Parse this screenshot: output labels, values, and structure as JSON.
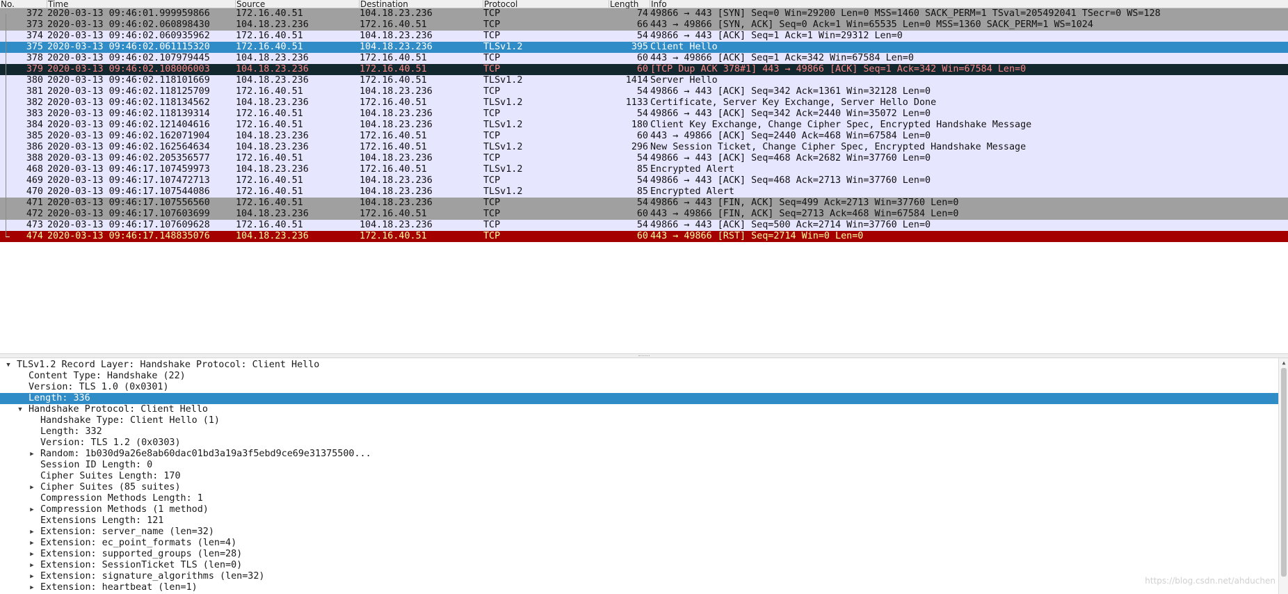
{
  "columns": {
    "no": "No.",
    "time": "Time",
    "source": "Source",
    "destination": "Destination",
    "protocol": "Protocol",
    "length": "Length",
    "info": "Info"
  },
  "colors": {
    "tcp_gray": "#a0a0a0",
    "lavender": "#e7e6ff",
    "selected": "#308cc6",
    "bad_tcp": "#12272e",
    "bad_tcp_text": "#f78787",
    "rst_red": "#a40000",
    "rst_text": "#ffffa0"
  },
  "packets": [
    {
      "no": "372",
      "time": "2020-03-13 09:46:01.999959866",
      "src": "172.16.40.51",
      "dst": "104.18.23.236",
      "proto": "TCP",
      "len": "74",
      "info": "49866 → 443 [SYN] Seq=0 Win=29200 Len=0 MSS=1460 SACK_PERM=1 TSval=205492041 TSecr=0 WS=128",
      "style": "gray"
    },
    {
      "no": "373",
      "time": "2020-03-13 09:46:02.060898430",
      "src": "104.18.23.236",
      "dst": "172.16.40.51",
      "proto": "TCP",
      "len": "66",
      "info": "443 → 49866 [SYN, ACK] Seq=0 Ack=1 Win=65535 Len=0 MSS=1360 SACK_PERM=1 WS=1024",
      "style": "gray"
    },
    {
      "no": "374",
      "time": "2020-03-13 09:46:02.060935962",
      "src": "172.16.40.51",
      "dst": "104.18.23.236",
      "proto": "TCP",
      "len": "54",
      "info": "49866 → 443 [ACK] Seq=1 Ack=1 Win=29312 Len=0",
      "style": "lavender"
    },
    {
      "no": "375",
      "time": "2020-03-13 09:46:02.061115320",
      "src": "172.16.40.51",
      "dst": "104.18.23.236",
      "proto": "TLSv1.2",
      "len": "395",
      "info": "Client Hello",
      "style": "selected"
    },
    {
      "no": "378",
      "time": "2020-03-13 09:46:02.107979445",
      "src": "104.18.23.236",
      "dst": "172.16.40.51",
      "proto": "TCP",
      "len": "60",
      "info": "443 → 49866 [ACK] Seq=1 Ack=342 Win=67584 Len=0",
      "style": "lavender"
    },
    {
      "no": "379",
      "time": "2020-03-13 09:46:02.108006003",
      "src": "104.18.23.236",
      "dst": "172.16.40.51",
      "proto": "TCP",
      "len": "60",
      "info": "[TCP Dup ACK 378#1] 443 → 49866 [ACK] Seq=1 Ack=342 Win=67584 Len=0",
      "style": "bad"
    },
    {
      "no": "380",
      "time": "2020-03-13 09:46:02.118101669",
      "src": "104.18.23.236",
      "dst": "172.16.40.51",
      "proto": "TLSv1.2",
      "len": "1414",
      "info": "Server Hello",
      "style": "lavender"
    },
    {
      "no": "381",
      "time": "2020-03-13 09:46:02.118125709",
      "src": "172.16.40.51",
      "dst": "104.18.23.236",
      "proto": "TCP",
      "len": "54",
      "info": "49866 → 443 [ACK] Seq=342 Ack=1361 Win=32128 Len=0",
      "style": "lavender"
    },
    {
      "no": "382",
      "time": "2020-03-13 09:46:02.118134562",
      "src": "104.18.23.236",
      "dst": "172.16.40.51",
      "proto": "TLSv1.2",
      "len": "1133",
      "info": "Certificate, Server Key Exchange, Server Hello Done",
      "style": "lavender"
    },
    {
      "no": "383",
      "time": "2020-03-13 09:46:02.118139314",
      "src": "172.16.40.51",
      "dst": "104.18.23.236",
      "proto": "TCP",
      "len": "54",
      "info": "49866 → 443 [ACK] Seq=342 Ack=2440 Win=35072 Len=0",
      "style": "lavender"
    },
    {
      "no": "384",
      "time": "2020-03-13 09:46:02.121404616",
      "src": "172.16.40.51",
      "dst": "104.18.23.236",
      "proto": "TLSv1.2",
      "len": "180",
      "info": "Client Key Exchange, Change Cipher Spec, Encrypted Handshake Message",
      "style": "lavender"
    },
    {
      "no": "385",
      "time": "2020-03-13 09:46:02.162071904",
      "src": "104.18.23.236",
      "dst": "172.16.40.51",
      "proto": "TCP",
      "len": "60",
      "info": "443 → 49866 [ACK] Seq=2440 Ack=468 Win=67584 Len=0",
      "style": "lavender"
    },
    {
      "no": "386",
      "time": "2020-03-13 09:46:02.162564634",
      "src": "104.18.23.236",
      "dst": "172.16.40.51",
      "proto": "TLSv1.2",
      "len": "296",
      "info": "New Session Ticket, Change Cipher Spec, Encrypted Handshake Message",
      "style": "lavender"
    },
    {
      "no": "388",
      "time": "2020-03-13 09:46:02.205356577",
      "src": "172.16.40.51",
      "dst": "104.18.23.236",
      "proto": "TCP",
      "len": "54",
      "info": "49866 → 443 [ACK] Seq=468 Ack=2682 Win=37760 Len=0",
      "style": "lavender"
    },
    {
      "no": "468",
      "time": "2020-03-13 09:46:17.107459973",
      "src": "104.18.23.236",
      "dst": "172.16.40.51",
      "proto": "TLSv1.2",
      "len": "85",
      "info": "Encrypted Alert",
      "style": "lavender"
    },
    {
      "no": "469",
      "time": "2020-03-13 09:46:17.107472713",
      "src": "172.16.40.51",
      "dst": "104.18.23.236",
      "proto": "TCP",
      "len": "54",
      "info": "49866 → 443 [ACK] Seq=468 Ack=2713 Win=37760 Len=0",
      "style": "lavender"
    },
    {
      "no": "470",
      "time": "2020-03-13 09:46:17.107544086",
      "src": "172.16.40.51",
      "dst": "104.18.23.236",
      "proto": "TLSv1.2",
      "len": "85",
      "info": "Encrypted Alert",
      "style": "lavender"
    },
    {
      "no": "471",
      "time": "2020-03-13 09:46:17.107556560",
      "src": "172.16.40.51",
      "dst": "104.18.23.236",
      "proto": "TCP",
      "len": "54",
      "info": "49866 → 443 [FIN, ACK] Seq=499 Ack=2713 Win=37760 Len=0",
      "style": "gray"
    },
    {
      "no": "472",
      "time": "2020-03-13 09:46:17.107603699",
      "src": "104.18.23.236",
      "dst": "172.16.40.51",
      "proto": "TCP",
      "len": "60",
      "info": "443 → 49866 [FIN, ACK] Seq=2713 Ack=468 Win=67584 Len=0",
      "style": "gray"
    },
    {
      "no": "473",
      "time": "2020-03-13 09:46:17.107609628",
      "src": "172.16.40.51",
      "dst": "104.18.23.236",
      "proto": "TCP",
      "len": "54",
      "info": "49866 → 443 [ACK] Seq=500 Ack=2714 Win=37760 Len=0",
      "style": "lavender"
    },
    {
      "no": "474",
      "time": "2020-03-13 09:46:17.148835076",
      "src": "104.18.23.236",
      "dst": "172.16.40.51",
      "proto": "TCP",
      "len": "60",
      "info": "443 → 49866 [RST] Seq=2714 Win=0 Len=0",
      "style": "rst"
    }
  ],
  "detail_tree": [
    {
      "text": "TLSv1.2 Record Layer: Handshake Protocol: Client Hello",
      "level": 0,
      "toggle": "open"
    },
    {
      "text": "Content Type: Handshake (22)",
      "level": 1,
      "toggle": "none"
    },
    {
      "text": "Version: TLS 1.0 (0x0301)",
      "level": 1,
      "toggle": "none"
    },
    {
      "text": "Length: 336",
      "level": 1,
      "toggle": "none",
      "selected": true
    },
    {
      "text": "Handshake Protocol: Client Hello",
      "level": 1,
      "toggle": "open"
    },
    {
      "text": "Handshake Type: Client Hello (1)",
      "level": 2,
      "toggle": "none"
    },
    {
      "text": "Length: 332",
      "level": 2,
      "toggle": "none"
    },
    {
      "text": "Version: TLS 1.2 (0x0303)",
      "level": 2,
      "toggle": "none"
    },
    {
      "text": "Random: 1b030d9a26e8ab60dac01bd3a19a3f5ebd9ce69e31375500...",
      "level": 2,
      "toggle": "closed"
    },
    {
      "text": "Session ID Length: 0",
      "level": 2,
      "toggle": "none"
    },
    {
      "text": "Cipher Suites Length: 170",
      "level": 2,
      "toggle": "none"
    },
    {
      "text": "Cipher Suites (85 suites)",
      "level": 2,
      "toggle": "closed"
    },
    {
      "text": "Compression Methods Length: 1",
      "level": 2,
      "toggle": "none"
    },
    {
      "text": "Compression Methods (1 method)",
      "level": 2,
      "toggle": "closed"
    },
    {
      "text": "Extensions Length: 121",
      "level": 2,
      "toggle": "none"
    },
    {
      "text": "Extension: server_name (len=32)",
      "level": 2,
      "toggle": "closed"
    },
    {
      "text": "Extension: ec_point_formats (len=4)",
      "level": 2,
      "toggle": "closed"
    },
    {
      "text": "Extension: supported_groups (len=28)",
      "level": 2,
      "toggle": "closed"
    },
    {
      "text": "Extension: SessionTicket TLS (len=0)",
      "level": 2,
      "toggle": "closed"
    },
    {
      "text": "Extension: signature_algorithms (len=32)",
      "level": 2,
      "toggle": "closed"
    },
    {
      "text": "Extension: heartbeat (len=1)",
      "level": 2,
      "toggle": "closed"
    }
  ],
  "watermark": "https://blog.csdn.net/ahduchen"
}
